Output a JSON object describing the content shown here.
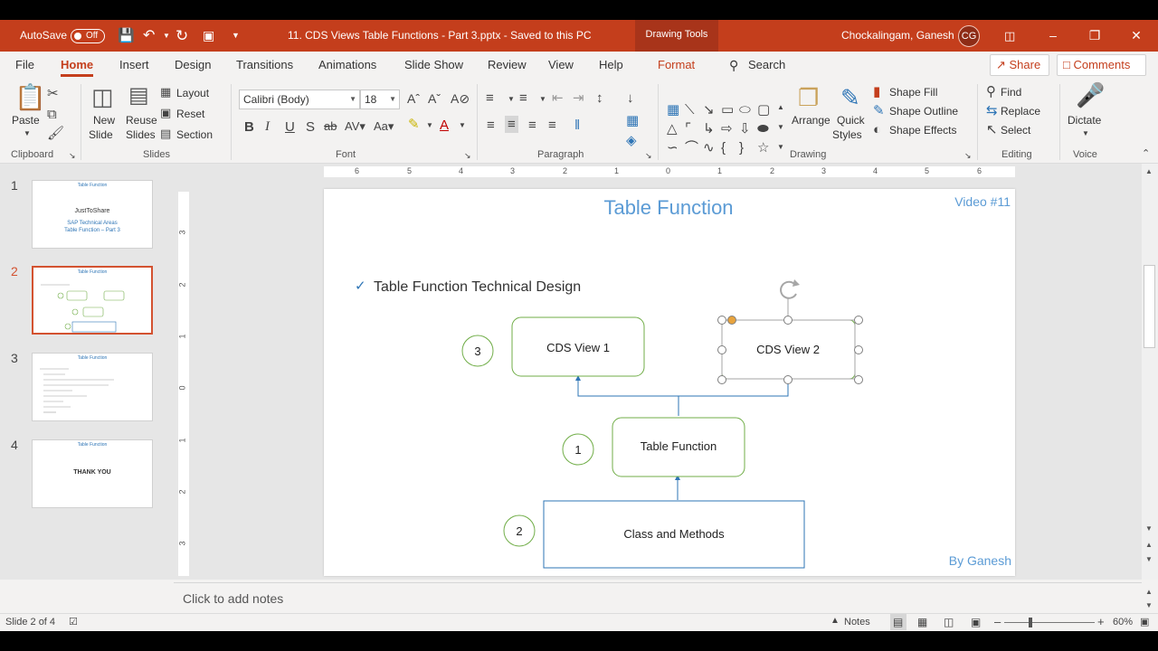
{
  "titlebar": {
    "autosave_label": "AutoSave",
    "autosave_state": "Off",
    "doc_title": "11. CDS Views Table Functions - Part 3.pptx  -  Saved to this PC",
    "context_tab": "Drawing Tools",
    "user_name": "Chockalingam, Ganesh",
    "user_initials": "CG",
    "bg_color": "#c43e1c"
  },
  "menu": {
    "tabs": [
      "File",
      "Home",
      "Insert",
      "Design",
      "Transitions",
      "Animations",
      "Slide Show",
      "Review",
      "View",
      "Help",
      "Format"
    ],
    "active": "Home",
    "search": "Search",
    "share": "Share",
    "comments": "Comments"
  },
  "ribbon": {
    "clipboard": {
      "label": "Clipboard",
      "paste": "Paste"
    },
    "slides": {
      "label": "Slides",
      "new_slide_1": "New",
      "new_slide_2": "Slide",
      "reuse_1": "Reuse",
      "reuse_2": "Slides",
      "layout": "Layout",
      "reset": "Reset",
      "section": "Section"
    },
    "font": {
      "label": "Font",
      "font_name": "Calibri (Body)",
      "font_size": "18"
    },
    "paragraph": {
      "label": "Paragraph"
    },
    "drawing": {
      "label": "Drawing",
      "arrange": "Arrange",
      "quick_1": "Quick",
      "quick_2": "Styles",
      "shape_fill": "Shape Fill",
      "shape_outline": "Shape Outline",
      "shape_effects": "Shape Effects"
    },
    "editing": {
      "label": "Editing",
      "find": "Find",
      "replace": "Replace",
      "select": "Select"
    },
    "voice": {
      "label": "Voice",
      "dictate": "Dictate"
    }
  },
  "thumbnails": [
    {
      "num": "1",
      "title": "Table Function",
      "lines": [
        "JustToShare",
        "SAP Technical Areas",
        "Table Function – Part 3"
      ]
    },
    {
      "num": "2",
      "title": "Table Function",
      "lines": []
    },
    {
      "num": "3",
      "title": "Table Function",
      "lines": []
    },
    {
      "num": "4",
      "title": "Table Function",
      "lines": [
        "THANK YOU"
      ]
    }
  ],
  "ruler_h": [
    "6",
    "5",
    "4",
    "3",
    "2",
    "1",
    "0",
    "1",
    "2",
    "3",
    "4",
    "5",
    "6"
  ],
  "ruler_v": [
    "3",
    "2",
    "1",
    "0",
    "1",
    "2",
    "3"
  ],
  "slide": {
    "title": "Table Function",
    "video": "Video #11",
    "bullet": "Table Function Technical Design",
    "author": "By Ganesh",
    "boxes": {
      "cds1": "CDS View 1",
      "cds2": "CDS View 2",
      "tf": "Table Function",
      "cm": "Class and Methods"
    },
    "circles": {
      "c3": "3",
      "c1": "1",
      "c2": "2"
    },
    "green": "#70ad47",
    "blue": "#2e75b6"
  },
  "notes_placeholder": "Click to add notes",
  "status": {
    "slide_info": "Slide 2 of 4",
    "notes": "Notes",
    "zoom": "60%"
  }
}
